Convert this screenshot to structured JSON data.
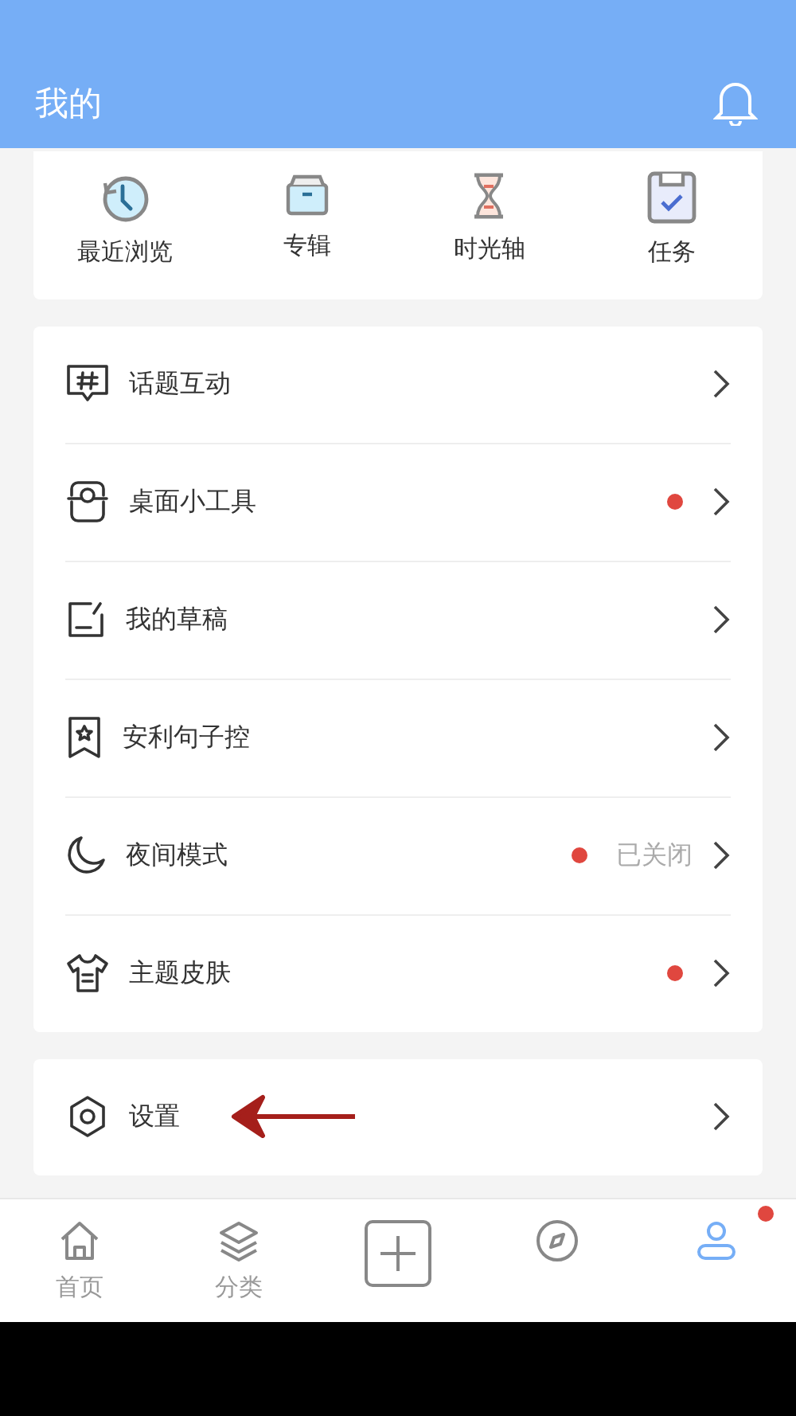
{
  "header": {
    "title": "我的"
  },
  "shortcuts": [
    {
      "label": "最近浏览"
    },
    {
      "label": "专辑"
    },
    {
      "label": "时光轴"
    },
    {
      "label": "任务"
    }
  ],
  "menu": [
    {
      "label": "话题互动",
      "badge": false
    },
    {
      "label": "桌面小工具",
      "badge": true
    },
    {
      "label": "我的草稿",
      "badge": false
    },
    {
      "label": "安利句子控",
      "badge": false
    },
    {
      "label": "夜间模式",
      "badge": true,
      "value": "已关闭"
    },
    {
      "label": "主题皮肤",
      "badge": true
    }
  ],
  "settings": {
    "label": "设置",
    "annotated": true
  },
  "tab_bar": [
    {
      "label": "首页",
      "selected": false,
      "badge": false
    },
    {
      "label": "分类",
      "selected": false,
      "badge": false
    },
    {
      "kind": "add",
      "selected": false,
      "badge": false
    },
    {
      "selected": false,
      "badge": false
    },
    {
      "selected": true,
      "badge": true
    }
  ]
}
